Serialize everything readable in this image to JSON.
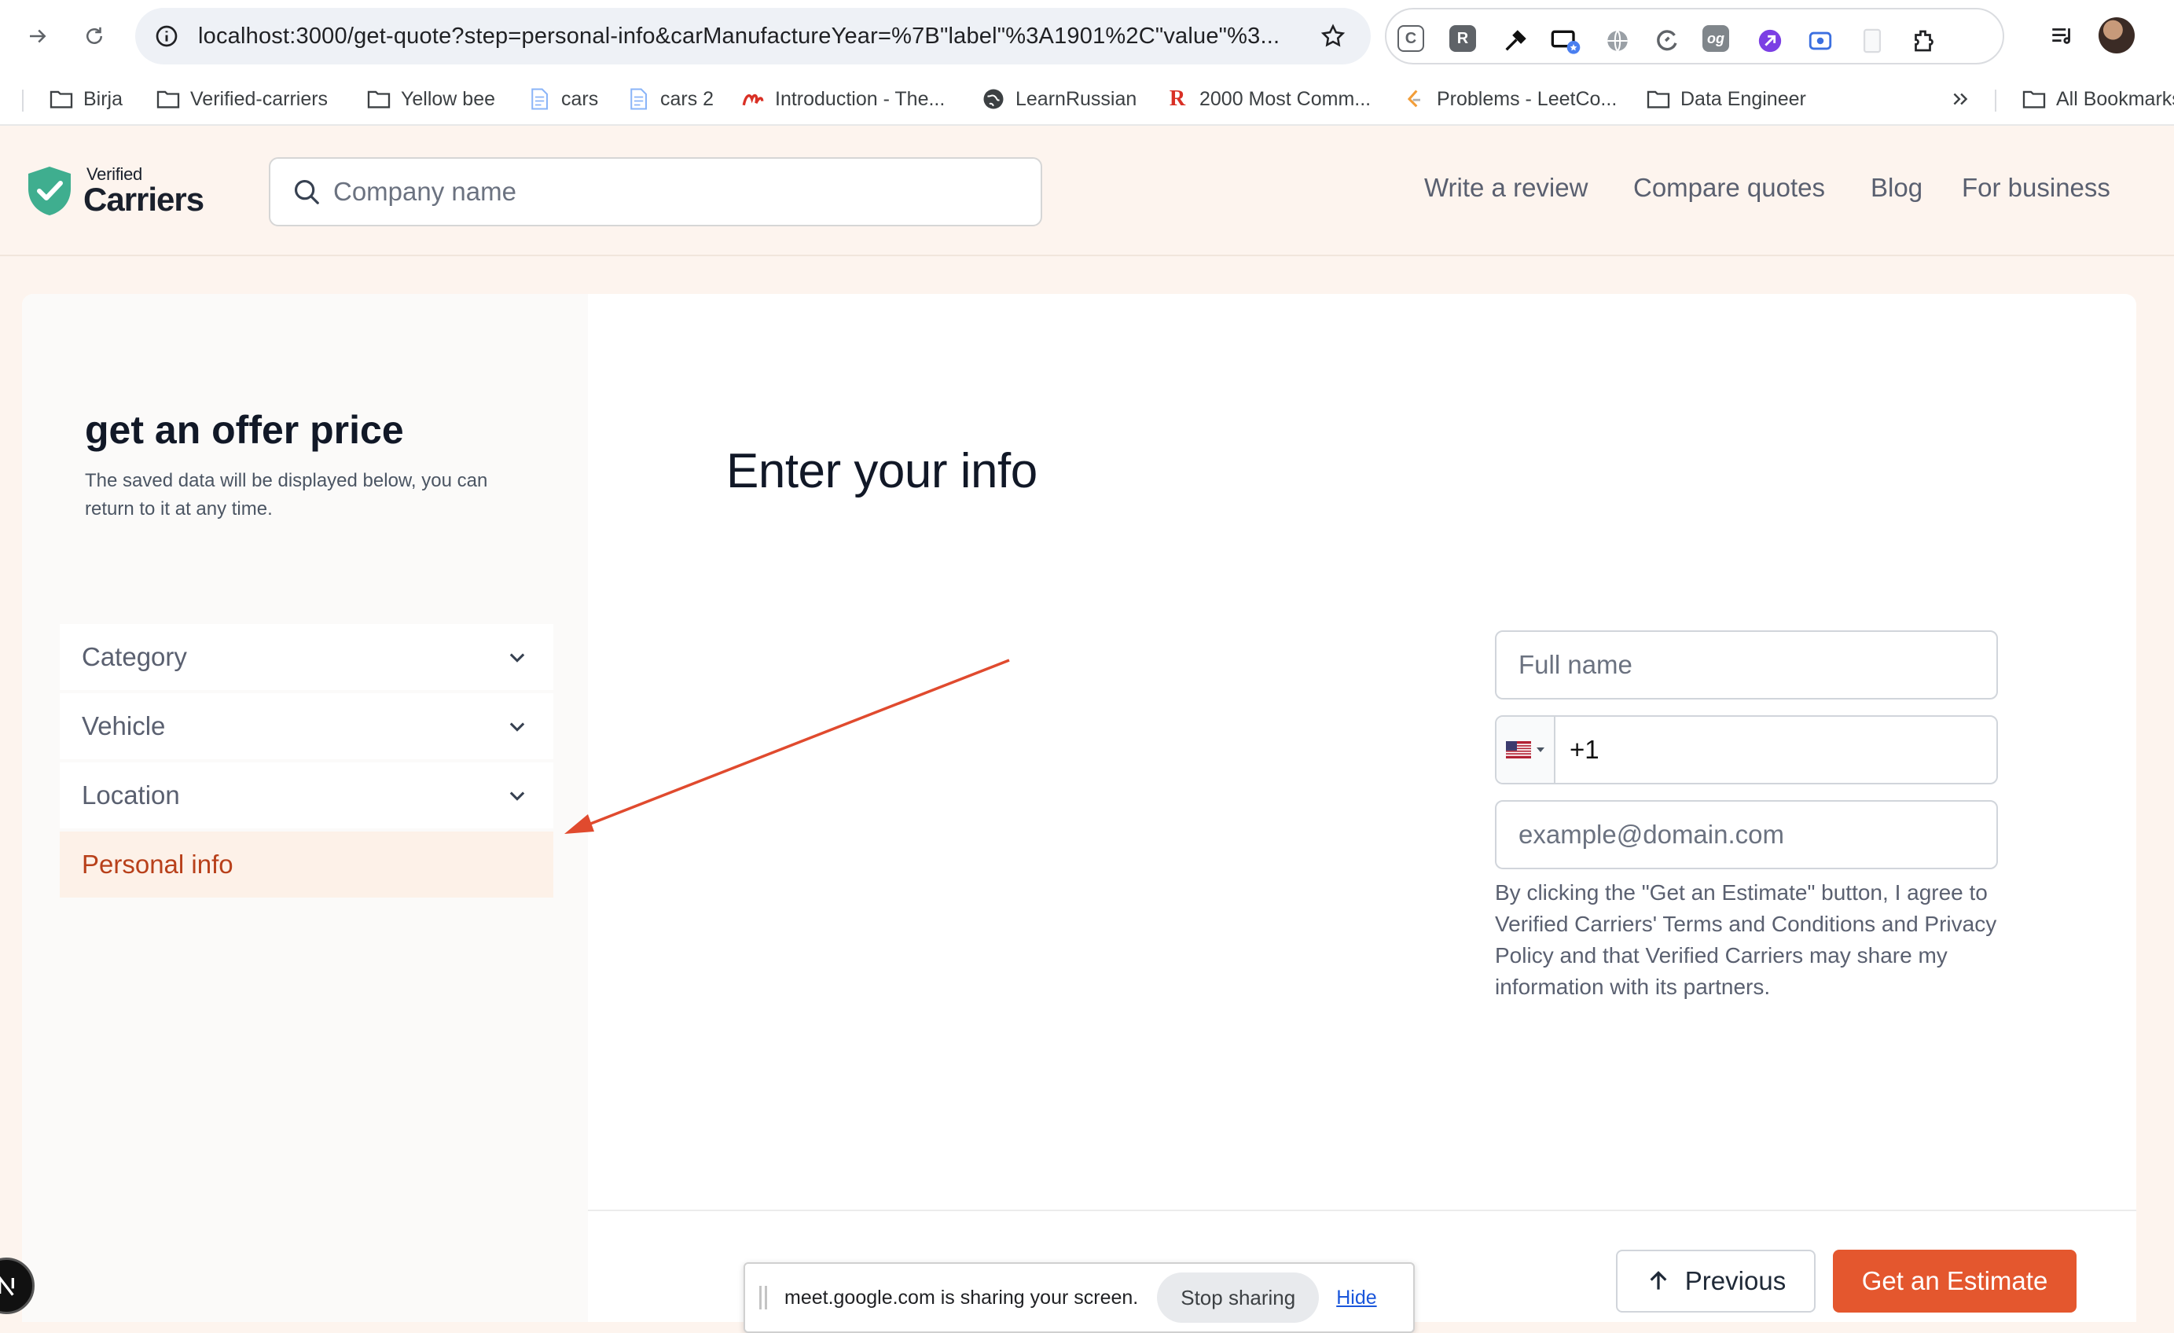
{
  "browser": {
    "url": "localhost:3000/get-quote?step=personal-info&carManufactureYear=%7B\"label\"%3A1901%2C\"value\"%3...",
    "bookmarks": [
      {
        "label": "Birja",
        "icon": "folder-icon"
      },
      {
        "label": "Verified-carriers",
        "icon": "folder-icon"
      },
      {
        "label": "Yellow bee",
        "icon": "folder-icon"
      },
      {
        "label": "cars",
        "icon": "doc-icon"
      },
      {
        "label": "cars 2",
        "icon": "doc-icon"
      },
      {
        "label": "Introduction - The...",
        "icon": "site-icon"
      },
      {
        "label": "LearnRussian",
        "icon": "globe-icon"
      },
      {
        "label": "2000 Most Comm...",
        "icon": "r-icon"
      },
      {
        "label": "Problems - LeetCo...",
        "icon": "leetcode-icon"
      },
      {
        "label": "Data Engineer",
        "icon": "folder-icon"
      }
    ],
    "all_bookmarks": "All Bookmarks"
  },
  "header": {
    "logo_small": "Verified",
    "logo_big": "Carriers",
    "search_placeholder": "Company name",
    "nav": [
      "Write a review",
      "Compare quotes",
      "Blog",
      "For business"
    ]
  },
  "sidebar": {
    "title": "get an offer price",
    "description": "The saved data will be displayed below, you can return to it at any time.",
    "steps": [
      {
        "label": "Category",
        "active": false
      },
      {
        "label": "Vehicle",
        "active": false
      },
      {
        "label": "Location",
        "active": false
      },
      {
        "label": "Personal info",
        "active": true
      }
    ]
  },
  "form": {
    "title": "Enter your info",
    "full_name_placeholder": "Full name",
    "phone_value": "+1",
    "email_placeholder": "example@domain.com",
    "terms": "By clicking the \"Get an Estimate\" button, I agree to Verified Carriers' Terms and Conditions and Privacy Policy and that Verified Carriers may share my information with its partners.",
    "previous_label": "Previous",
    "submit_label": "Get an Estimate"
  },
  "share_bar": {
    "text": "meet.google.com is sharing your screen.",
    "stop_label": "Stop sharing",
    "hide_label": "Hide"
  },
  "colors": {
    "accent": "#e4572e",
    "active_step_text": "#b8401a",
    "logo_green": "#3fae8f",
    "annotation_red": "#e04a2e"
  }
}
